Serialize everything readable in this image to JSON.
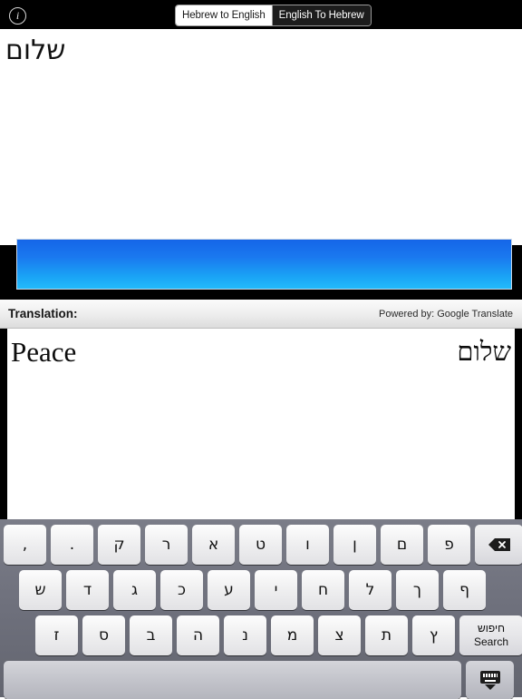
{
  "topbar": {
    "info_icon": "info-icon",
    "segments": [
      {
        "label": "Hebrew to English",
        "selected": true
      },
      {
        "label": "English To Hebrew",
        "selected": false
      }
    ]
  },
  "input": {
    "value": "שלום",
    "placeholder": ""
  },
  "ad": {
    "label": "advertisement-banner"
  },
  "translation": {
    "header_label": "Translation:",
    "powered_by": "Powered by: Google Translate",
    "english_text": "Peace",
    "hebrew_text": "שלום"
  },
  "keyboard": {
    "rows": [
      {
        "name": "keyboard-row-1",
        "keys": [
          {
            "label": ",",
            "name": "key-comma",
            "type": "char"
          },
          {
            "label": ".",
            "name": "key-period",
            "type": "char"
          },
          {
            "label": "ק",
            "name": "key-qof",
            "type": "char"
          },
          {
            "label": "ר",
            "name": "key-resh",
            "type": "char"
          },
          {
            "label": "א",
            "name": "key-alef",
            "type": "char"
          },
          {
            "label": "ט",
            "name": "key-tet",
            "type": "char"
          },
          {
            "label": "ו",
            "name": "key-vav",
            "type": "char"
          },
          {
            "label": "ן",
            "name": "key-final-nun",
            "type": "char"
          },
          {
            "label": "ם",
            "name": "key-final-mem",
            "type": "char"
          },
          {
            "label": "פ",
            "name": "key-pe",
            "type": "char"
          },
          {
            "label": "",
            "name": "key-backspace",
            "type": "delete"
          }
        ]
      },
      {
        "name": "keyboard-row-2",
        "keys": [
          {
            "label": "ש",
            "name": "key-shin",
            "type": "char"
          },
          {
            "label": "ד",
            "name": "key-dalet",
            "type": "char"
          },
          {
            "label": "ג",
            "name": "key-gimel",
            "type": "char"
          },
          {
            "label": "כ",
            "name": "key-kaf",
            "type": "char"
          },
          {
            "label": "ע",
            "name": "key-ayin",
            "type": "char"
          },
          {
            "label": "י",
            "name": "key-yod",
            "type": "char"
          },
          {
            "label": "ח",
            "name": "key-het",
            "type": "char"
          },
          {
            "label": "ל",
            "name": "key-lamed",
            "type": "char"
          },
          {
            "label": "ך",
            "name": "key-final-kaf",
            "type": "char"
          },
          {
            "label": "ף",
            "name": "key-final-pe",
            "type": "char"
          }
        ]
      },
      {
        "name": "keyboard-row-3",
        "keys": [
          {
            "label": "ז",
            "name": "key-zayin",
            "type": "char"
          },
          {
            "label": "ס",
            "name": "key-samekh",
            "type": "char"
          },
          {
            "label": "ב",
            "name": "key-bet",
            "type": "char"
          },
          {
            "label": "ה",
            "name": "key-he",
            "type": "char"
          },
          {
            "label": "נ",
            "name": "key-nun",
            "type": "char"
          },
          {
            "label": "מ",
            "name": "key-mem",
            "type": "char"
          },
          {
            "label": "צ",
            "name": "key-tsadi",
            "type": "char"
          },
          {
            "label": "ת",
            "name": "key-tav",
            "type": "char"
          },
          {
            "label": "ץ",
            "name": "key-final-tsadi",
            "type": "char"
          },
          {
            "label": "חיפוש\nSearch",
            "label_he": "חיפוש",
            "label_en": "Search",
            "name": "key-search",
            "type": "search"
          }
        ]
      },
      {
        "name": "keyboard-row-4",
        "keys": [
          {
            "label": "",
            "name": "key-space",
            "type": "space"
          },
          {
            "label": "",
            "name": "key-dismiss-keyboard",
            "type": "dismiss"
          }
        ]
      }
    ]
  }
}
